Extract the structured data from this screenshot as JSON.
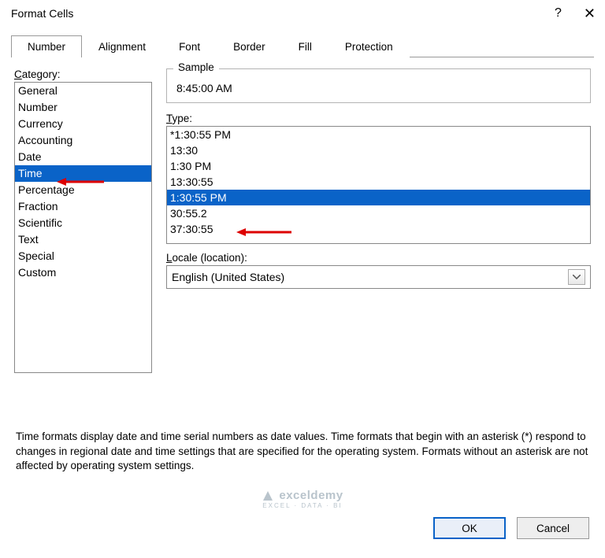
{
  "title": "Format Cells",
  "tabs": [
    "Number",
    "Alignment",
    "Font",
    "Border",
    "Fill",
    "Protection"
  ],
  "active_tab": 0,
  "category_label": "Category:",
  "categories": [
    "General",
    "Number",
    "Currency",
    "Accounting",
    "Date",
    "Time",
    "Percentage",
    "Fraction",
    "Scientific",
    "Text",
    "Special",
    "Custom"
  ],
  "category_selected": 5,
  "sample_label": "Sample",
  "sample_value": "8:45:00 AM",
  "type_label": "Type:",
  "types": [
    "*1:30:55 PM",
    "13:30",
    "1:30 PM",
    "13:30:55",
    "1:30:55 PM",
    "30:55.2",
    "37:30:55"
  ],
  "type_selected": 4,
  "locale_label": "Locale (location):",
  "locale_value": "English (United States)",
  "description": "Time formats display date and time serial numbers as date values.  Time formats that begin with an asterisk (*) respond to changes in regional date and time settings that are specified for the operating system. Formats without an asterisk are not affected by operating system settings.",
  "buttons": {
    "ok": "OK",
    "cancel": "Cancel"
  },
  "watermark": {
    "top": "exceldemy",
    "sub": "EXCEL · DATA · BI"
  }
}
